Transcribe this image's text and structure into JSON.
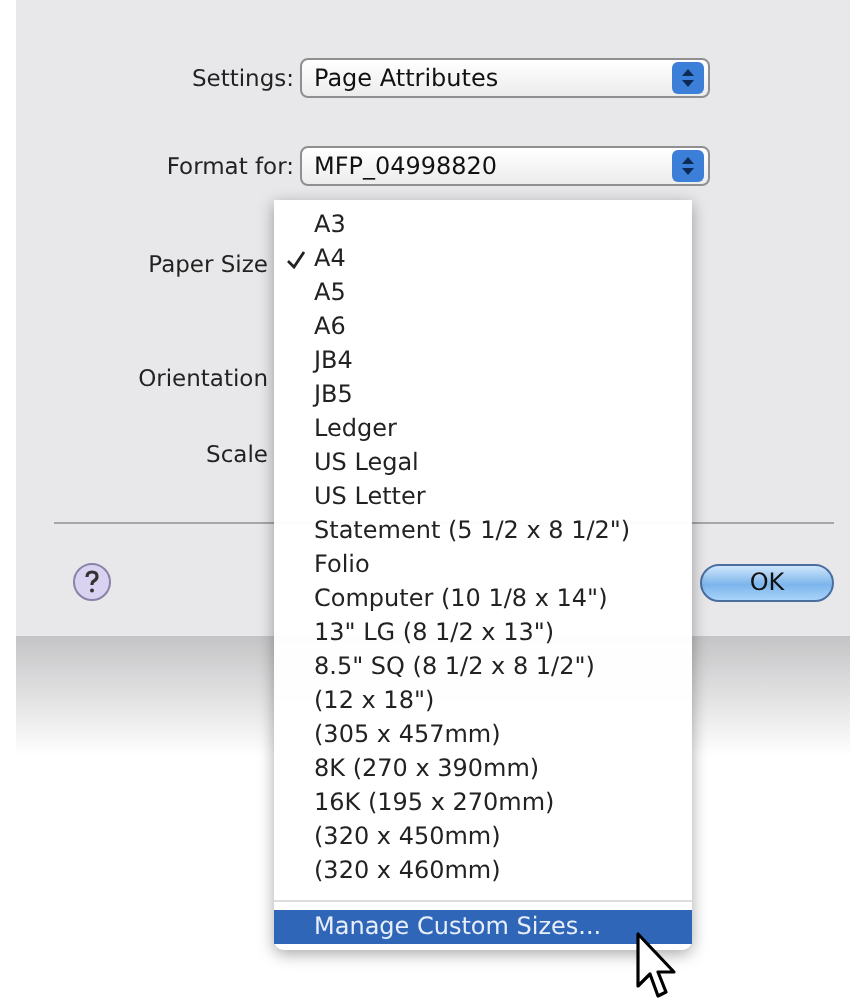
{
  "dialog": {
    "rows": [
      {
        "kind": "popup",
        "label": "Settings:",
        "value": "Page Attributes"
      },
      {
        "kind": "popup",
        "label": "Format for:",
        "value": "MFP_04998820"
      },
      {
        "kind": "label",
        "label": "Paper Size"
      },
      {
        "kind": "label",
        "label": "Orientation"
      },
      {
        "kind": "label",
        "label": "Scale"
      }
    ],
    "ok_button": "OK"
  },
  "paper_size_menu": {
    "items": [
      {
        "label": "A3",
        "checked": false
      },
      {
        "label": "A4",
        "checked": true
      },
      {
        "label": "A5",
        "checked": false
      },
      {
        "label": "A6",
        "checked": false
      },
      {
        "label": "JB4",
        "checked": false
      },
      {
        "label": "JB5",
        "checked": false
      },
      {
        "label": "Ledger",
        "checked": false
      },
      {
        "label": "US Legal",
        "checked": false
      },
      {
        "label": "US Letter",
        "checked": false
      },
      {
        "label": "Statement (5 1/2 x 8 1/2\")",
        "checked": false
      },
      {
        "label": "Folio",
        "checked": false
      },
      {
        "label": "Computer (10 1/8 x 14\")",
        "checked": false
      },
      {
        "label": "13\" LG (8 1/2 x 13\")",
        "checked": false
      },
      {
        "label": "8.5\" SQ (8 1/2 x 8 1/2\")",
        "checked": false
      },
      {
        "label": "(12 x 18\")",
        "checked": false
      },
      {
        "label": "(305 x 457mm)",
        "checked": false
      },
      {
        "label": "8K (270 x 390mm)",
        "checked": false
      },
      {
        "label": "16K (195 x 270mm)",
        "checked": false
      },
      {
        "label": "(320 x 450mm)",
        "checked": false
      },
      {
        "label": "(320 x 460mm)",
        "checked": false
      }
    ],
    "custom_item": {
      "label": "Manage Custom Sizes...",
      "highlighted": true
    }
  }
}
